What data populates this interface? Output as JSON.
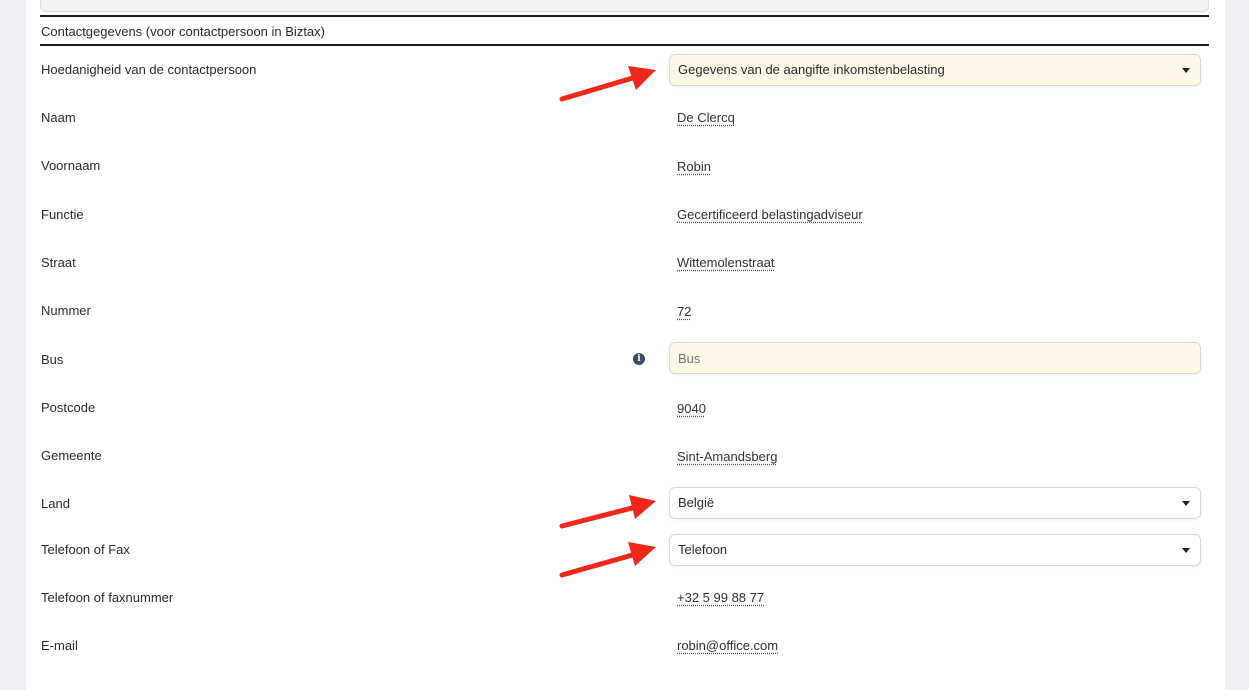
{
  "section": {
    "title": "Contactgegevens (voor contactpersoon in Biztax)"
  },
  "fields": {
    "hoedanigheid": {
      "label": "Hoedanigheid van de contactpersoon",
      "value": "Gegevens van de aangifte inkomstenbelasting"
    },
    "naam": {
      "label": "Naam",
      "value": "De Clercq"
    },
    "voornaam": {
      "label": "Voornaam",
      "value": "Robin"
    },
    "functie": {
      "label": "Functie",
      "value": "Gecertificeerd belastingadviseur"
    },
    "straat": {
      "label": "Straat",
      "value": "Wittemolenstraat"
    },
    "nummer": {
      "label": "Nummer",
      "value": "72"
    },
    "bus": {
      "label": "Bus",
      "placeholder": "Bus",
      "info_icon": "info-icon"
    },
    "postcode": {
      "label": "Postcode",
      "value": "9040"
    },
    "gemeente": {
      "label": "Gemeente",
      "value": "Sint-Amandsberg"
    },
    "land": {
      "label": "Land",
      "value": "België"
    },
    "telefoon_of_fax": {
      "label": "Telefoon of Fax",
      "value": "Telefoon"
    },
    "telefoonnummer": {
      "label": "Telefoon of faxnummer",
      "value": "+32 5 99 88 77"
    },
    "email": {
      "label": "E-mail",
      "value": "robin@office.com"
    }
  },
  "colors": {
    "highlight_field": "#fff8e8",
    "annotation_arrow": "#f0271b",
    "info_icon": "#3c4a5e"
  }
}
